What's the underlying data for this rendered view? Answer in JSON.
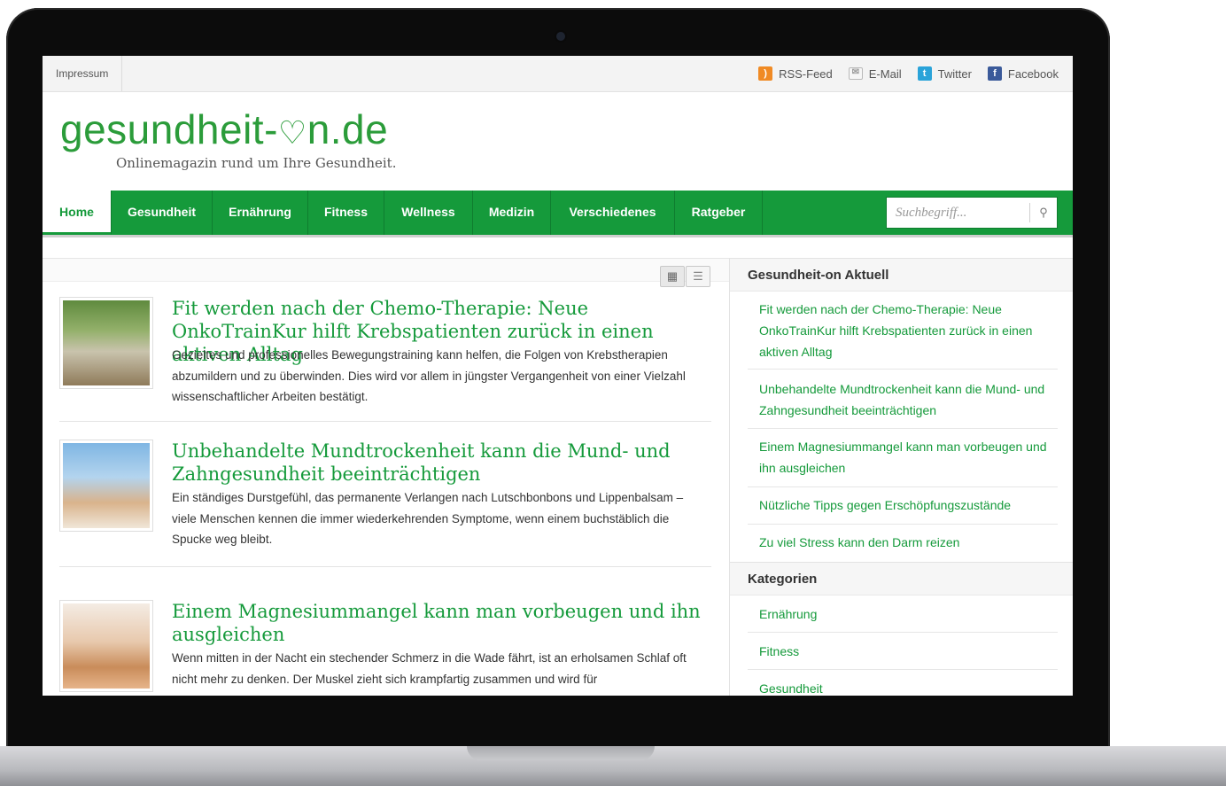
{
  "topbar": {
    "impressum": "Impressum",
    "links": [
      {
        "label": "RSS-Feed",
        "icon": "rss-icon"
      },
      {
        "label": "E-Mail",
        "icon": "mail-icon"
      },
      {
        "label": "Twitter",
        "icon": "twitter-icon"
      },
      {
        "label": "Facebook",
        "icon": "facebook-icon"
      }
    ]
  },
  "logo": {
    "text_a": "gesundheit-",
    "text_b": "n.de",
    "tagline": "Onlinemagazin rund um Ihre Gesundheit."
  },
  "nav": {
    "items": [
      "Home",
      "Gesundheit",
      "Ernährung",
      "Fitness",
      "Wellness",
      "Medizin",
      "Verschiedenes",
      "Ratgeber"
    ],
    "active": "Home",
    "search_placeholder": "Suchbegriff..."
  },
  "posts": [
    {
      "title": "Fit werden nach der Chemo-Therapie: Neue OnkoTrainKur hilft Krebspatienten zurück in einen aktiven Alltag",
      "excerpt": "Gezieltes und professionelles Bewegungstraining kann helfen, die Folgen von Krebstherapien abzumildern und zu überwinden. Dies wird vor allem in jüngster Vergangenheit von einer Vielzahl wissenschaftlicher Arbeiten bestätigt."
    },
    {
      "title": "Unbehandelte Mundtrockenheit kann die Mund- und Zahngesundheit beeinträchtigen",
      "excerpt": "Ein ständiges Durstgefühl, das permanente Verlangen nach Lutschbonbons und Lippenbalsam – viele Menschen kennen die immer wiederkehrenden Symptome, wenn einem buchstäblich die Spucke weg bleibt."
    },
    {
      "title": "Einem Magnesiummangel kann man vorbeugen und ihn ausgleichen",
      "excerpt": "Wenn mitten in der Nacht ein stechender Schmerz in die Wade fährt, ist an erholsamen Schlaf oft nicht mehr zu denken. Der Muskel zieht sich krampfartig zusammen und wird für"
    }
  ],
  "sidebar": {
    "aktuell_title": "Gesundheit-on Aktuell",
    "aktuell": [
      "Fit werden nach der Chemo-Therapie: Neue OnkoTrainKur hilft Krebspatienten zurück in einen aktiven Alltag",
      "Unbehandelte Mundtrockenheit kann die Mund- und Zahngesundheit beeinträchtigen",
      "Einem Magnesiummangel kann man vorbeugen und ihn ausgleichen",
      "Nützliche Tipps gegen Erschöpfungszustände",
      "Zu viel Stress kann den Darm reizen"
    ],
    "kategorien_title": "Kategorien",
    "kategorien": [
      "Ernährung",
      "Fitness",
      "Gesundheit"
    ]
  },
  "colors": {
    "brand_green": "#159a3b",
    "logo_green": "#2b9c3a"
  }
}
